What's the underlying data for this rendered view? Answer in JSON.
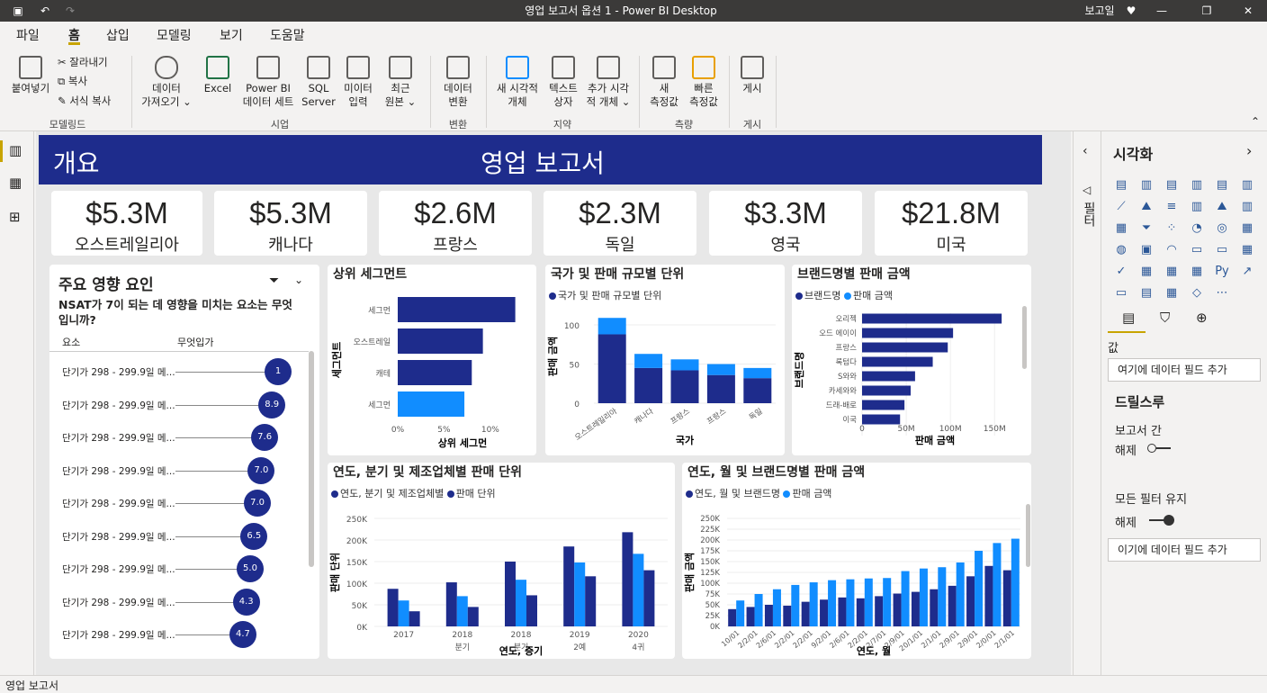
{
  "window": {
    "title": "영업 보고서 옵션 1 - Power BI Desktop",
    "user_label": "보고일"
  },
  "menu": {
    "file": "파일",
    "home": "홈",
    "insert": "삽입",
    "modeling": "모델링",
    "view": "보기",
    "help": "도움말"
  },
  "ribbon": {
    "paste": "붙여넣기",
    "cut": "잘라내기",
    "copy": "복사",
    "format_painter": "서식 복사",
    "get_data": "데이터\n가져오기 ⌄",
    "excel": "Excel",
    "pbi_dataset": "Power BI\n데이터 세트",
    "sql": "SQL\nServer",
    "enter_data": "미이터\n입력",
    "recent_sources": "최근\n원본 ⌄",
    "transform": "데이터\n변환",
    "new_visual": "새 시각적\n개체",
    "text_box": "텍스트\n상자",
    "more_visuals": "추가 시각\n적 개체 ⌄",
    "new_measure": "새\n측정값",
    "quick_measure": "빠른\n측정값",
    "publish": "게시",
    "groups": {
      "clipboard": "모델링드",
      "data": "시업",
      "queries": "변환",
      "insert": "지약",
      "calculations": "측량",
      "share": "게시"
    }
  },
  "report": {
    "header_left": "개요",
    "header_title": "영업 보고서",
    "kpis": [
      {
        "value": "$5.3M",
        "label": "오스트레일리아"
      },
      {
        "value": "$5.3M",
        "label": "캐나다"
      },
      {
        "value": "$2.6M",
        "label": "프랑스"
      },
      {
        "value": "$2.3M",
        "label": "독일"
      },
      {
        "value": "$3.3M",
        "label": "영국"
      },
      {
        "value": "$21.8M",
        "label": "미국"
      }
    ],
    "key_influencers": {
      "title": "주요 영향 요인",
      "question": "NSAT가 7이 되는 데 영향을 미치는 요소는 무엇입니까?",
      "col_factor": "요소",
      "col_likely": "무엇입가",
      "rows": [
        {
          "label": "단기가 298 - 299.9일 메...",
          "value": "1",
          "level": 1.0
        },
        {
          "label": "단기가 298 - 299.9일 메...",
          "value": "8.9",
          "level": 0.89
        },
        {
          "label": "단기가 298 - 299.9일 메...",
          "value": "7.6",
          "level": 0.76
        },
        {
          "label": "단기가 298 - 299.9일 메...",
          "value": "7.0",
          "level": 0.7
        },
        {
          "label": "단기가 298 - 299.9일 메...",
          "value": "7.0",
          "level": 0.63
        },
        {
          "label": "단기가 298 - 299.9일 메...",
          "value": "6.5",
          "level": 0.57
        },
        {
          "label": "단기가 298 - 299.9일 메...",
          "value": "5.0",
          "level": 0.5
        },
        {
          "label": "단기가 298 - 299.9일 메...",
          "value": "4.3",
          "level": 0.43
        },
        {
          "label": "단기가 298 - 299.9일 메...",
          "value": "4.7",
          "level": 0.37
        }
      ]
    }
  },
  "right_pane": {
    "title": "시각화",
    "filters_label": "필터",
    "values_label": "값",
    "add_field": "여기에 데이터 필드 추가",
    "drillthrough": "드릴스루",
    "cross_report": "보고서 간",
    "cross_report_state": "해제",
    "keep_filters": "모든 필터 유지",
    "keep_filters_state": "해제",
    "add_field2": "이기에 데이터 필드 추가",
    "icons": [
      "▤",
      "▥",
      "▤",
      "▥",
      "▤",
      "▥",
      "⟋",
      "⛰",
      "≡",
      "▥",
      "⛰",
      "▥",
      "▦",
      "⏷",
      "⁘",
      "◔",
      "◎",
      "▦",
      "◍",
      "▣",
      "◠",
      "▭",
      "▭",
      "▦",
      "✓",
      "▦",
      "▦",
      "▦",
      "Py",
      "↗",
      "▭",
      "▤",
      "▦",
      "◇",
      "⋯"
    ]
  },
  "status": {
    "page_tab": "영업 보고서"
  },
  "chart_data": [
    {
      "type": "bar",
      "title": "상위 세그먼트",
      "categories": [
        "세그먼",
        "오스트레일",
        "캐테",
        "세그먼"
      ],
      "values": [
        12.7,
        9.2,
        8.0,
        7.2
      ],
      "xlabel": "상위 세그먼",
      "ylabel": "세그먼트",
      "xticks": [
        "0%",
        "5%",
        "10%"
      ],
      "xlim": [
        0,
        14
      ]
    },
    {
      "type": "bar",
      "title": "국가 및 판매 규모별 단위",
      "legend": "국가 및 판매 규모별 단위",
      "categories": [
        "오스트레일리아",
        "캐나다",
        "프랑스",
        "프랑스",
        "독일"
      ],
      "series": [
        {
          "values": [
            88,
            45,
            42,
            36,
            32
          ]
        },
        {
          "values": [
            21,
            18,
            14,
            14,
            13
          ]
        }
      ],
      "xlabel": "국가",
      "ylabel": "판매 금액",
      "yticks": [
        "0",
        "50",
        "100"
      ],
      "ylim": [
        0,
        115
      ]
    },
    {
      "type": "bar",
      "title": "브랜드명별 판매 금액",
      "legend": [
        "브랜드명",
        "판매 금액"
      ],
      "categories": [
        "오리젝",
        "오드 에이이",
        "프랑스",
        "록텀다",
        "S와와",
        "카세와와",
        "드래-배로",
        "이국"
      ],
      "values": [
        158,
        103,
        97,
        80,
        60,
        55,
        48,
        43
      ],
      "xlabel": "판매 금액",
      "ylabel": "브랜드명",
      "xticks": [
        "0",
        "50M",
        "100M",
        "150M"
      ],
      "xlim": [
        0,
        165
      ]
    },
    {
      "type": "bar",
      "title": "연도, 분기 및 제조업체별 판매 단위",
      "legend": [
        "연도, 분기 및 제조업체별",
        "판매 단위"
      ],
      "categories": [
        "2017",
        "2018\n분기",
        "2018\n분기",
        "2019\n2예",
        "2020\n4귀"
      ],
      "series": [
        {
          "values": [
            87,
            102,
            150,
            185,
            218
          ]
        },
        {
          "values": [
            60,
            70,
            108,
            148,
            168
          ]
        },
        {
          "values": [
            35,
            45,
            72,
            116,
            130
          ]
        }
      ],
      "xlabel": "연도, 증기",
      "ylabel": "판매 단위",
      "yticks": [
        "0K",
        "50K",
        "100K",
        "150K",
        "200K",
        "250K"
      ],
      "ylim": [
        0,
        250
      ]
    },
    {
      "type": "bar",
      "title": "연도, 월 및 브랜드명별 판매 금액",
      "legend": [
        "연도, 월 및 브랜드명",
        "판매 금액"
      ],
      "categories": [
        "10/01",
        "2/2/01",
        "2/6/01",
        "2/2/01",
        "2/2/01",
        "9/2/01",
        "2/6/01",
        "2/2/01",
        "2/7/01",
        "2/9/01",
        "20/1/01",
        "2/1/01",
        "2/9/01",
        "2/9/01",
        "2/0/01",
        "2/1/01"
      ],
      "series": [
        {
          "values": [
            40,
            45,
            50,
            48,
            57,
            62,
            67,
            65,
            70,
            76,
            80,
            86,
            94,
            116,
            140,
            130
          ]
        },
        {
          "values": [
            60,
            75,
            86,
            96,
            102,
            107,
            109,
            111,
            112,
            128,
            134,
            137,
            148,
            175,
            193,
            203
          ]
        }
      ],
      "xlabel": "연도, 월",
      "ylabel": "판매 금액",
      "yticks": [
        "0K",
        "25K",
        "50K",
        "75K",
        "100K",
        "125K",
        "150K",
        "175K",
        "200K",
        "225K",
        "250K"
      ],
      "ylim": [
        0,
        250
      ]
    }
  ]
}
